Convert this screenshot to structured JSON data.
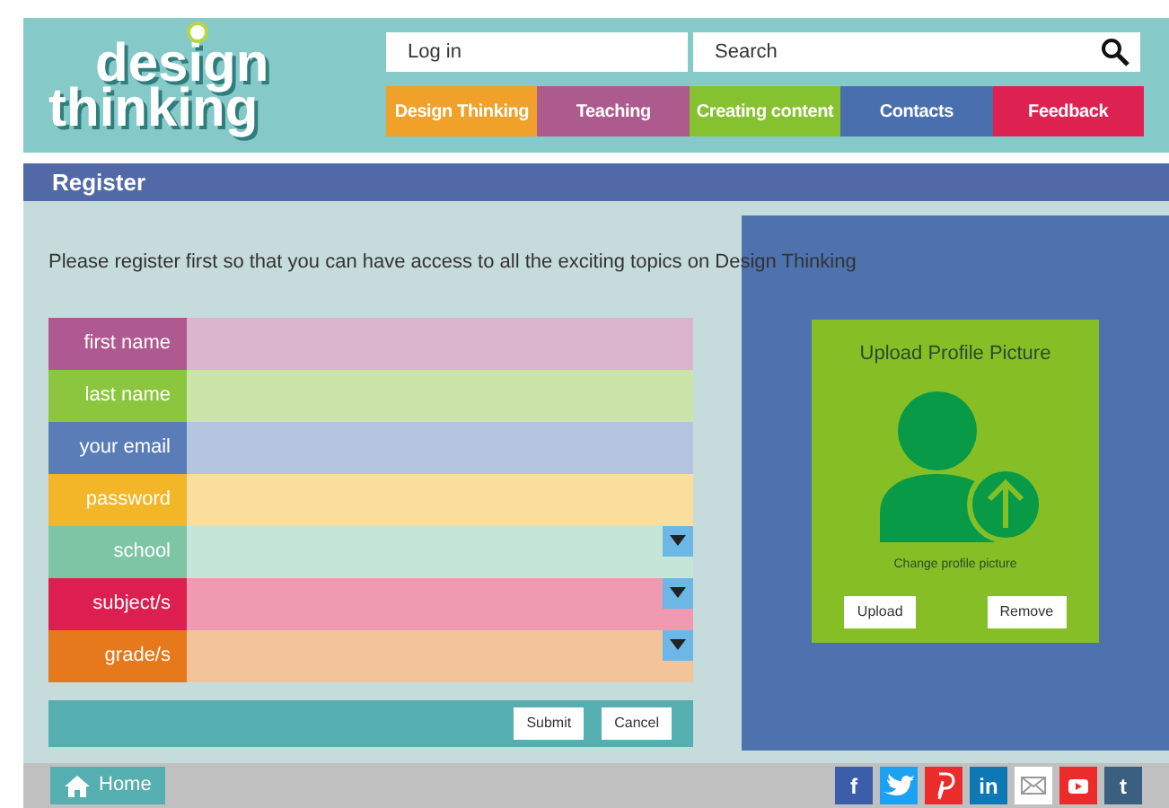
{
  "header": {
    "logo": {
      "line_1": "design",
      "line_2": "thinking"
    },
    "login": {
      "placeholder": "Log in"
    },
    "search": {
      "placeholder": "Search"
    },
    "nav": [
      {
        "label": "Design Thinking",
        "color": "#efa12a"
      },
      {
        "label": "Teaching",
        "color": "#ad5a8f"
      },
      {
        "label": "Creating content",
        "color": "#86c22f"
      },
      {
        "label": "Contacts",
        "color": "#4a6fae"
      },
      {
        "label": "Feedback",
        "color": "#dd2252"
      }
    ]
  },
  "page_title": "Register",
  "intro": "Please register first so that you can have access to all the exciting topics on Design Thinking",
  "form": {
    "fields": [
      {
        "label": "first name",
        "kind": "text",
        "color": "#ae5990"
      },
      {
        "label": "last name",
        "kind": "text",
        "color": "#8cc63f"
      },
      {
        "label": "your email",
        "kind": "text",
        "color": "#5a7db8"
      },
      {
        "label": "password",
        "kind": "text",
        "color": "#f3b628"
      },
      {
        "label": "school",
        "kind": "select",
        "color": "#7ec5a4"
      },
      {
        "label": "subject/s",
        "kind": "select",
        "color": "#dc1f4f"
      },
      {
        "label": "grade/s",
        "kind": "select",
        "color": "#e5791c"
      }
    ],
    "buttons": [
      "Submit",
      "Cancel"
    ]
  },
  "profile": {
    "title": "Upload Profile Picture",
    "caption": "Change profile picture",
    "buttons": [
      "Upload",
      "Remove"
    ]
  },
  "footer": {
    "home": "Home",
    "social": [
      {
        "kind": "letter",
        "label": "f",
        "color": "#3b5ea8"
      },
      {
        "kind": "bird",
        "color": "#1da1f2"
      },
      {
        "kind": "pin",
        "color": "#ec2b2b"
      },
      {
        "kind": "letter",
        "label": "in",
        "color": "#0e78b5"
      },
      {
        "kind": "mail",
        "color": "#ffffff"
      },
      {
        "kind": "play",
        "color": "#ec2b2b"
      },
      {
        "kind": "letter",
        "label": "t",
        "color": "#3b5f80"
      }
    ]
  }
}
